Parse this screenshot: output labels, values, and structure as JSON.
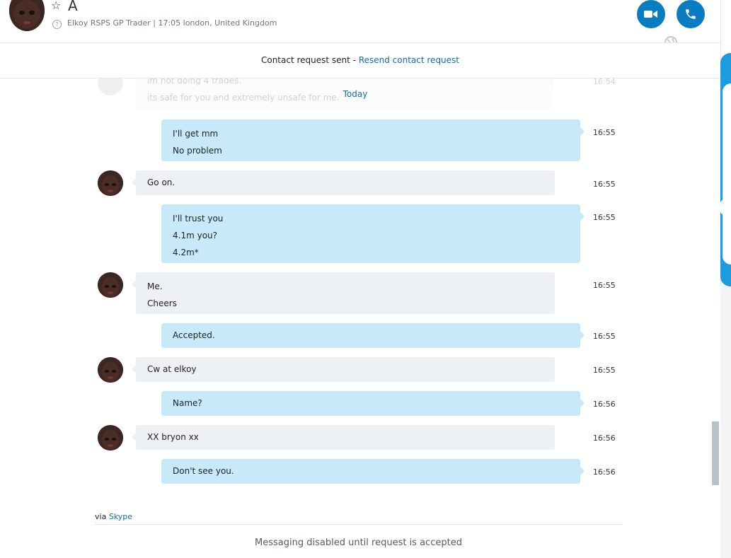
{
  "header": {
    "contact_name": "A",
    "info": "Elkoy RSPS GP Trader | 17:05 london, United Kingdom",
    "info_icon": "?"
  },
  "request_bar": {
    "text": "Contact request sent - ",
    "link": "Resend contact request"
  },
  "faded_message": {
    "lines": [
      "im not doing 4 trades.",
      "its safe for you and extremely unsafe for me."
    ],
    "time": "16:54"
  },
  "day_separator": "Today",
  "messages": [
    {
      "from": "me",
      "lines": [
        "I'll get mm",
        "No problem"
      ],
      "time": "16:55"
    },
    {
      "from": "them",
      "lines": [
        "Go on."
      ],
      "time": "16:55"
    },
    {
      "from": "me",
      "lines": [
        "I'll trust you",
        "4.1m you?",
        "4.2m*"
      ],
      "time": "16:55"
    },
    {
      "from": "them",
      "lines": [
        "Me.",
        "Cheers"
      ],
      "time": "16:55"
    },
    {
      "from": "me",
      "lines": [
        "Accepted."
      ],
      "time": "16:55"
    },
    {
      "from": "them",
      "lines": [
        "Cw at elkoy"
      ],
      "time": "16:55"
    },
    {
      "from": "me",
      "lines": [
        "Name?"
      ],
      "time": "16:56"
    },
    {
      "from": "them",
      "lines": [
        "XX bryon xx"
      ],
      "time": "16:56"
    },
    {
      "from": "me",
      "lines": [
        "Don't see you."
      ],
      "time": "16:56"
    }
  ],
  "footer": {
    "via_prefix": "via ",
    "via_link": "Skype",
    "disabled_text": "Messaging disabled until request is accepted"
  },
  "colors": {
    "accent": "#0a7cc1",
    "link": "#0f6ea5",
    "my_bubble": "#c7e9f9",
    "their_bubble": "#eef1f4"
  }
}
